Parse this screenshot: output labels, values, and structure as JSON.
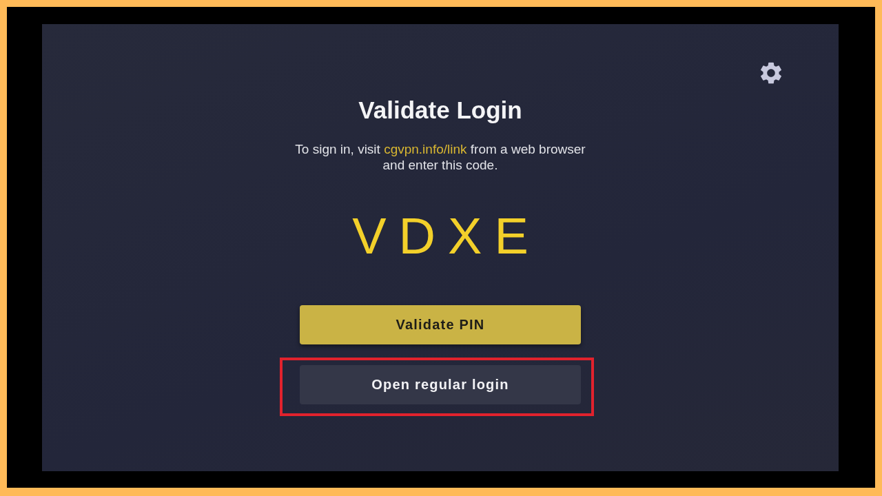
{
  "screen": {
    "title": "Validate Login",
    "instructions": {
      "lead": "To sign in, visit",
      "link": "cgvpn.info/link",
      "tail": "from a web browser",
      "second_line": "and enter this code."
    },
    "code": "VDXE",
    "buttons": [
      {
        "label": "Validate PIN",
        "kind": "primary",
        "highlighted": false
      },
      {
        "label": "Open regular login",
        "kind": "secondary",
        "highlighted": true
      }
    ]
  }
}
